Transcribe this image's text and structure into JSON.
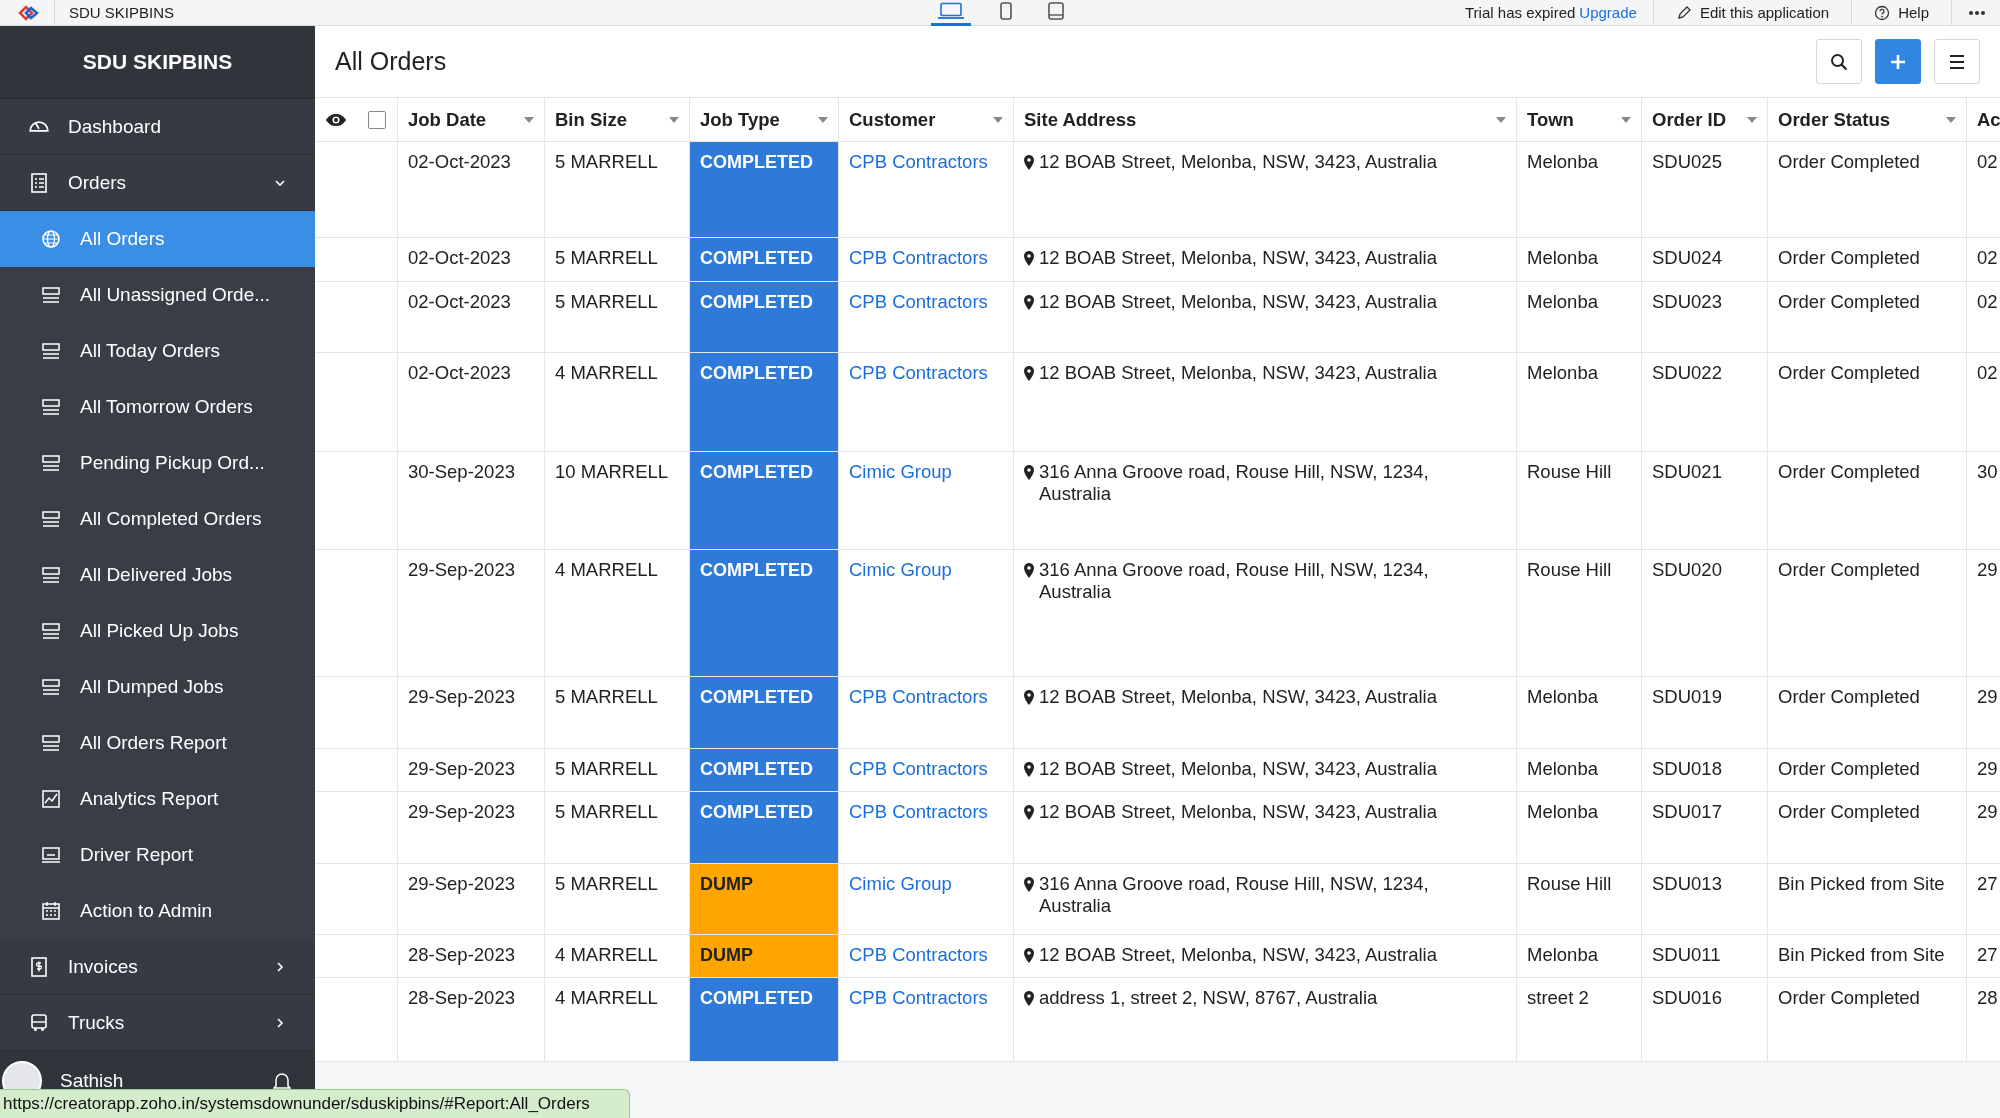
{
  "top_bar": {
    "app_name": "SDU SKIPBINS",
    "devices": [
      {
        "selected": true
      },
      {
        "selected": false
      },
      {
        "selected": false
      }
    ],
    "trial_notice": "Trial has expired",
    "upgrade_link": "Upgrade",
    "edit_button": "Edit this application",
    "help_button": "Help"
  },
  "sidebar": {
    "title": "SDU SKIPBINS",
    "items": [
      {
        "label": "Dashboard",
        "kind": "link"
      },
      {
        "label": "Orders",
        "kind": "group",
        "expanded": true,
        "children": [
          {
            "label": "All Orders",
            "selected": true
          },
          {
            "label": "All Unassigned Orde...",
            "selected": false
          },
          {
            "label": "All Today Orders",
            "selected": false
          },
          {
            "label": "All Tomorrow Orders",
            "selected": false
          },
          {
            "label": "Pending Pickup Ord...",
            "selected": false
          },
          {
            "label": "All Completed Orders",
            "selected": false
          },
          {
            "label": "All Delivered Jobs",
            "selected": false
          },
          {
            "label": "All Picked Up Jobs",
            "selected": false
          },
          {
            "label": "All Dumped Jobs",
            "selected": false
          },
          {
            "label": "All Orders Report",
            "selected": false
          },
          {
            "label": "Analytics Report",
            "selected": false
          },
          {
            "label": "Driver Report",
            "selected": false
          },
          {
            "label": "Action to Admin",
            "selected": false
          }
        ]
      },
      {
        "label": "Invoices",
        "kind": "group",
        "expanded": false
      },
      {
        "label": "Trucks",
        "kind": "group",
        "expanded": false
      }
    ],
    "user": {
      "name": "Sathish"
    }
  },
  "page": {
    "title": "All Orders"
  },
  "table": {
    "select_all": {
      "checked": false
    },
    "columns": [
      "Job Date",
      "Bin Size",
      "Job Type",
      "Customer",
      "Site Address",
      "Town",
      "Order ID",
      "Order Status",
      "Ac"
    ],
    "rows": [
      {
        "job_date": "02-Oct-2023",
        "bin_size": "5 MARRELL",
        "job_type": {
          "label": "COMPLETED",
          "color": "#2f7ad8"
        },
        "customer": "CPB Contractors",
        "site_address": "12 BOAB Street, Melonba, NSW, 3423, Australia",
        "town": "Melonba",
        "order_id": "SDU025",
        "order_status": "Order Completed",
        "column_11": "02"
      },
      {
        "job_date": "02-Oct-2023",
        "bin_size": "5 MARRELL",
        "job_type": {
          "label": "COMPLETED",
          "color": "#2f7ad8"
        },
        "customer": "CPB Contractors",
        "site_address": "12 BOAB Street, Melonba, NSW, 3423, Australia",
        "town": "Melonba",
        "order_id": "SDU024",
        "order_status": "Order Completed",
        "column_11": "02"
      },
      {
        "job_date": "02-Oct-2023",
        "bin_size": "5 MARRELL",
        "job_type": {
          "label": "COMPLETED",
          "color": "#2f7ad8"
        },
        "customer": "CPB Contractors",
        "site_address": "12 BOAB Street, Melonba, NSW, 3423, Australia",
        "town": "Melonba",
        "order_id": "SDU023",
        "order_status": "Order Completed",
        "column_11": "02"
      },
      {
        "job_date": "02-Oct-2023",
        "bin_size": "4 MARRELL",
        "job_type": {
          "label": "COMPLETED",
          "color": "#2f7ad8"
        },
        "customer": "CPB Contractors",
        "site_address": "12 BOAB Street, Melonba, NSW, 3423, Australia",
        "town": "Melonba",
        "order_id": "SDU022",
        "order_status": "Order Completed",
        "column_11": "02"
      },
      {
        "job_date": "30-Sep-2023",
        "bin_size": "10 MARRELL",
        "job_type": {
          "label": "COMPLETED",
          "color": "#2f7ad8"
        },
        "customer": "Cimic Group",
        "site_address": "316 Anna Groove road, Rouse Hill, NSW, 1234, Australia",
        "town": "Rouse Hill",
        "order_id": "SDU021",
        "order_status": "Order Completed",
        "column_11": "30"
      },
      {
        "job_date": "29-Sep-2023",
        "bin_size": "4 MARRELL",
        "job_type": {
          "label": "COMPLETED",
          "color": "#2f7ad8"
        },
        "customer": "Cimic Group",
        "site_address": "316 Anna Groove road, Rouse Hill, NSW, 1234, Australia",
        "town": "Rouse Hill",
        "order_id": "SDU020",
        "order_status": "Order Completed",
        "column_11": "29"
      },
      {
        "job_date": "29-Sep-2023",
        "bin_size": "5 MARRELL",
        "job_type": {
          "label": "COMPLETED",
          "color": "#2f7ad8"
        },
        "customer": "CPB Contractors",
        "site_address": "12 BOAB Street, Melonba, NSW, 3423, Australia",
        "town": "Melonba",
        "order_id": "SDU019",
        "order_status": "Order Completed",
        "column_11": "29"
      },
      {
        "job_date": "29-Sep-2023",
        "bin_size": "5 MARRELL",
        "job_type": {
          "label": "COMPLETED",
          "color": "#2f7ad8"
        },
        "customer": "CPB Contractors",
        "site_address": "12 BOAB Street, Melonba, NSW, 3423, Australia",
        "town": "Melonba",
        "order_id": "SDU018",
        "order_status": "Order Completed",
        "column_11": "29"
      },
      {
        "job_date": "29-Sep-2023",
        "bin_size": "5 MARRELL",
        "job_type": {
          "label": "COMPLETED",
          "color": "#2f7ad8"
        },
        "customer": "CPB Contractors",
        "site_address": "12 BOAB Street, Melonba, NSW, 3423, Australia",
        "town": "Melonba",
        "order_id": "SDU017",
        "order_status": "Order Completed",
        "column_11": "29"
      },
      {
        "job_date": "29-Sep-2023",
        "bin_size": "5 MARRELL",
        "job_type": {
          "label": "DUMP",
          "color": "#ffa500"
        },
        "customer": "Cimic Group",
        "site_address": "316 Anna Groove road, Rouse Hill, NSW, 1234, Australia",
        "town": "Rouse Hill",
        "order_id": "SDU013",
        "order_status": "Bin Picked from Site",
        "column_11": "27"
      },
      {
        "job_date": "28-Sep-2023",
        "bin_size": "4 MARRELL",
        "job_type": {
          "label": "DUMP",
          "color": "#ffa500"
        },
        "customer": "CPB Contractors",
        "site_address": "12 BOAB Street, Melonba, NSW, 3423, Australia",
        "town": "Melonba",
        "order_id": "SDU011",
        "order_status": "Bin Picked from Site",
        "column_11": "27"
      },
      {
        "job_date": "28-Sep-2023",
        "bin_size": "4 MARRELL",
        "job_type": {
          "label": "COMPLETED",
          "color": "#2f7ad8"
        },
        "customer": "CPB Contractors",
        "site_address": "address 1, street 2, NSW, 8767, Australia",
        "town": "street 2",
        "order_id": "SDU016",
        "order_status": "Order Completed",
        "column_11": "28"
      }
    ]
  },
  "status_bar": {
    "url": "https://creatorapp.zoho.in/systemsdownunder/sduskipbins/#Report:All_Orders"
  }
}
